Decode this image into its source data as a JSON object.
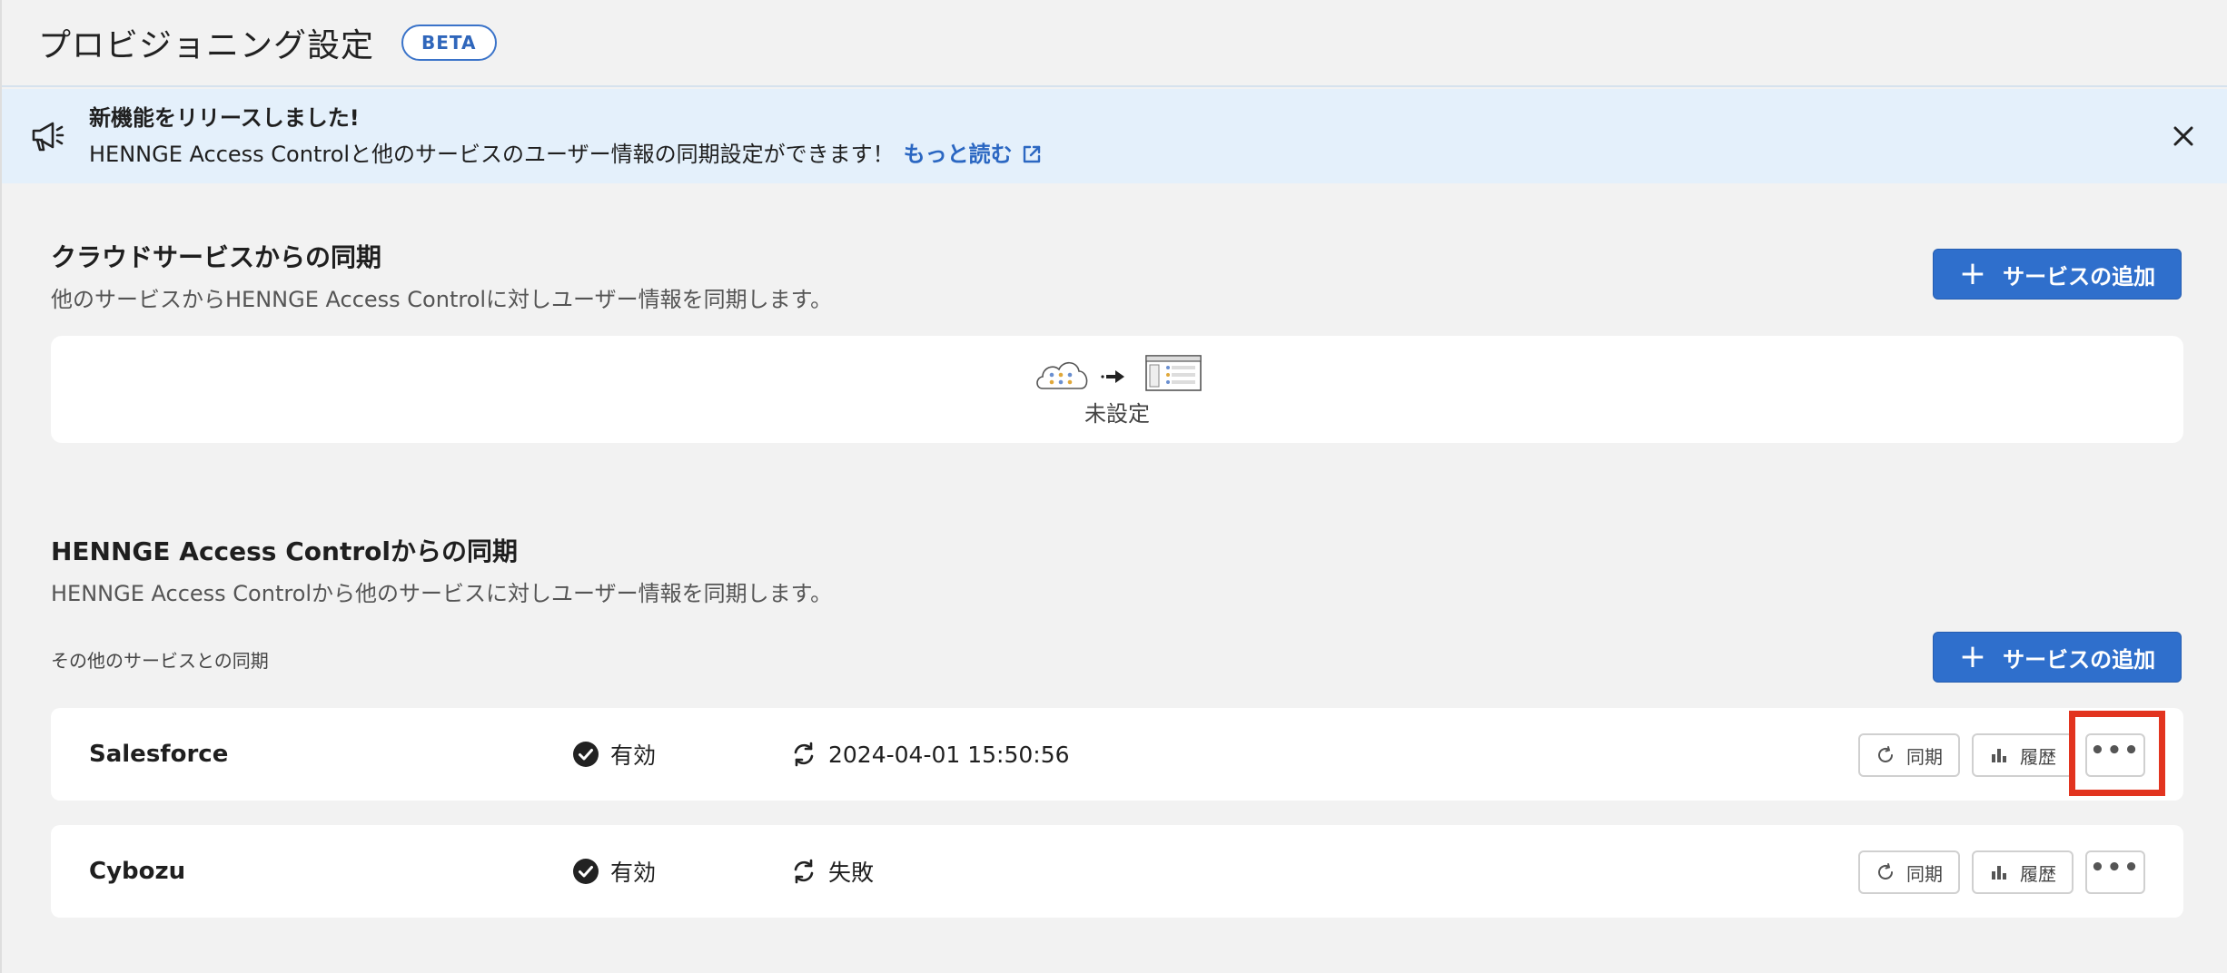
{
  "header": {
    "title": "プロビジョニング設定",
    "badge": "BETA"
  },
  "banner": {
    "title": "新機能をリリースしました!",
    "body": "HENNGE Access Controlと他のサービスのユーザー情報の同期設定ができます！",
    "link_label": "もっと読む",
    "icon": "megaphone-icon"
  },
  "cloud_sync": {
    "title": "クラウドサービスからの同期",
    "description": "他のサービスからHENNGE Access Controlに対しユーザー情報を同期します。",
    "add_button": "サービスの追加",
    "empty_label": "未設定"
  },
  "hac_sync": {
    "title": "HENNGE Access Controlからの同期",
    "description": "HENNGE Access Controlから他のサービスに対しユーザー情報を同期します。",
    "subheading": "その他のサービスとの同期",
    "add_button": "サービスの追加",
    "services": [
      {
        "name": "Salesforce",
        "status": "有効",
        "last_sync": "2024-04-01 15:50:56"
      },
      {
        "name": "Cybozu",
        "status": "有効",
        "last_sync": "失敗"
      }
    ],
    "sync_button": "同期",
    "history_button": "履歴",
    "more_button": "•••"
  },
  "colors": {
    "accent": "#2f6fcc",
    "banner_bg": "#e4f0fb",
    "highlight": "#e2341f"
  }
}
